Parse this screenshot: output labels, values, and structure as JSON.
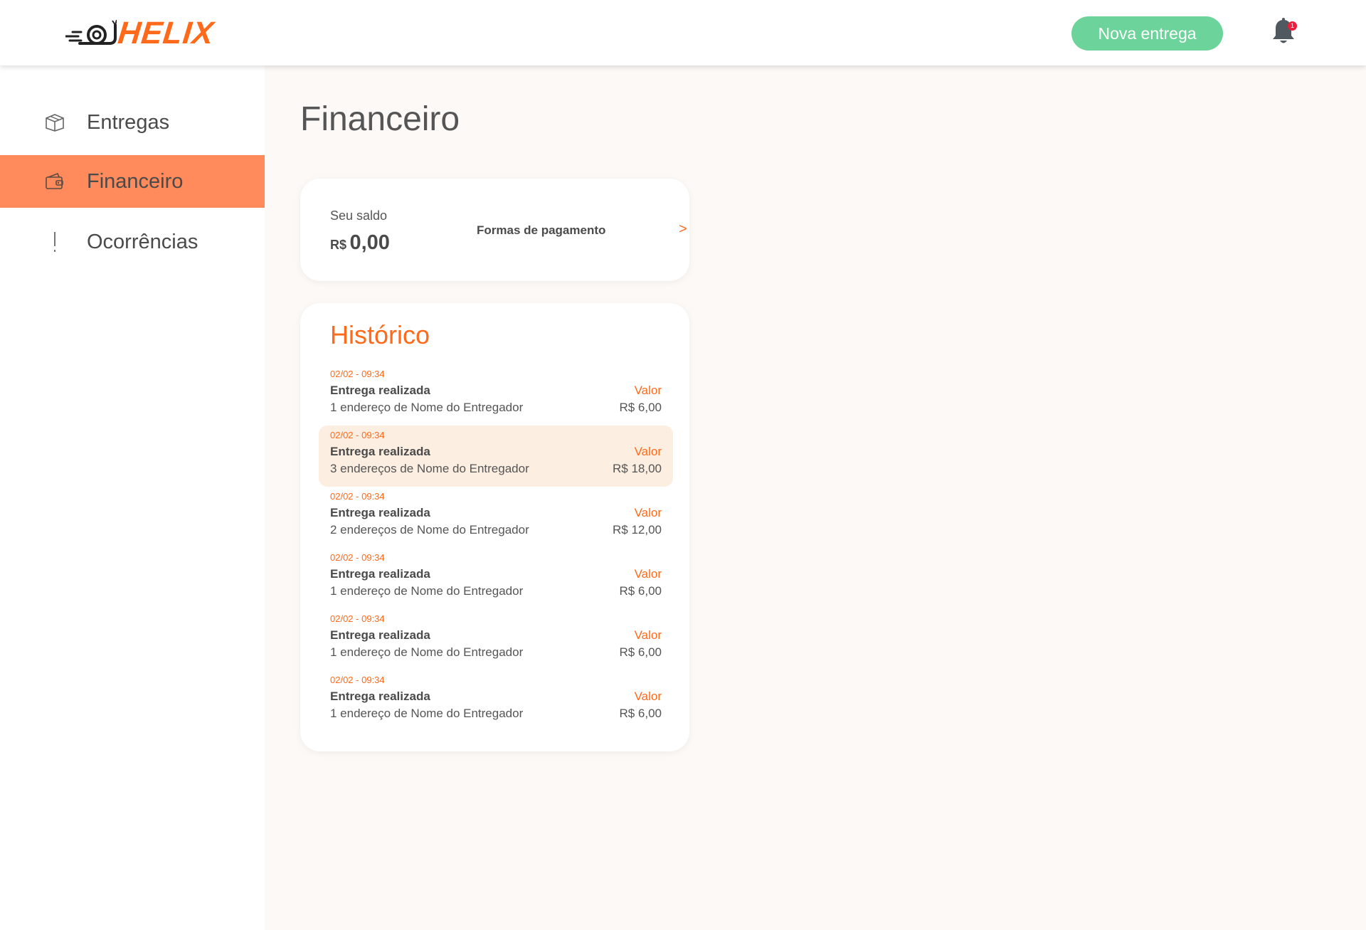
{
  "brand": {
    "name": "HELIX",
    "accent": "#ff6a1a"
  },
  "header": {
    "new_delivery_label": "Nova entrega",
    "notification_count": "1"
  },
  "sidebar": {
    "items": [
      {
        "label": "Entregas",
        "icon": "box-icon",
        "active": false
      },
      {
        "label": "Financeiro",
        "icon": "wallet-icon",
        "active": true
      },
      {
        "label": "Ocorrências",
        "icon": "exclamation-icon",
        "active": false
      }
    ]
  },
  "main": {
    "title": "Financeiro",
    "balance": {
      "label": "Seu saldo",
      "currency": "R$",
      "amount": "0,00",
      "payment_link": "Formas de pagamento",
      "arrow": ">"
    },
    "history": {
      "title": "Histórico",
      "items": [
        {
          "date": "02/02 - 09:34",
          "title": "Entrega realizada",
          "desc": "1 endereço de Nome do Entregador",
          "value_label": "Valor",
          "value": "R$ 6,00"
        },
        {
          "date": "02/02 - 09:34",
          "title": "Entrega realizada",
          "desc": "3 endereços de Nome do Entregador",
          "value_label": "Valor",
          "value": "R$ 18,00"
        },
        {
          "date": "02/02 - 09:34",
          "title": "Entrega realizada",
          "desc": "2 endereços de Nome do Entregador",
          "value_label": "Valor",
          "value": "R$ 12,00"
        },
        {
          "date": "02/02 - 09:34",
          "title": "Entrega realizada",
          "desc": "1 endereço de Nome do Entregador",
          "value_label": "Valor",
          "value": "R$ 6,00"
        },
        {
          "date": "02/02 - 09:34",
          "title": "Entrega realizada",
          "desc": "1 endereço de Nome do Entregador",
          "value_label": "Valor",
          "value": "R$ 6,00"
        },
        {
          "date": "02/02 - 09:34",
          "title": "Entrega realizada",
          "desc": "1 endereço de Nome do Entregador",
          "value_label": "Valor",
          "value": "R$ 6,00"
        }
      ]
    }
  },
  "colors": {
    "active_nav": "#ff8a5b",
    "button_green": "#6cd49a",
    "highlight_row": "#fdeee2",
    "badge_red": "#ef1d3b"
  }
}
